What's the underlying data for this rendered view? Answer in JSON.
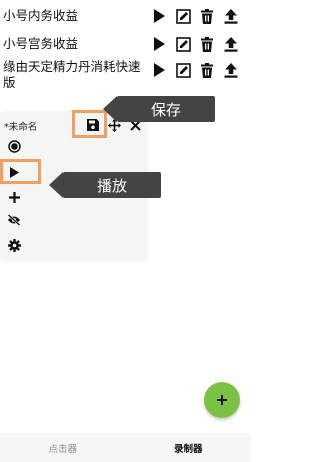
{
  "scripts": [
    {
      "name": "小号内务收益"
    },
    {
      "name": "小号宫务收益"
    },
    {
      "name": "缘由天定精力丹消耗快速版"
    }
  ],
  "recorder": {
    "title": "*未命名",
    "icons": [
      "save-icon",
      "move-icon",
      "close-icon",
      "record-icon",
      "play-icon",
      "plus-icon",
      "hide-icon",
      "settings-icon"
    ]
  },
  "annotations": {
    "save": "保存",
    "play": "播放"
  },
  "colors": {
    "highlight": "#f0a060",
    "fab": "#7cc242",
    "tag_bg": "#444444"
  },
  "bottom_nav": {
    "clicker": "点击器",
    "recorder": "录制器",
    "active": "recorder"
  }
}
